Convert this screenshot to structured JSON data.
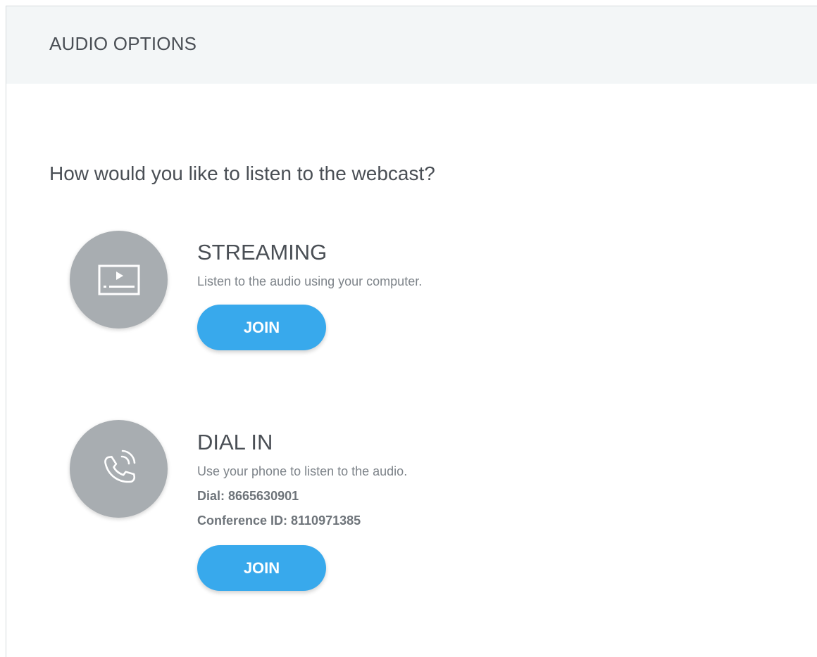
{
  "header": {
    "title": "AUDIO OPTIONS"
  },
  "prompt": {
    "question": "How would you like to listen to the webcast?"
  },
  "options": {
    "streaming": {
      "icon": "video-player-icon",
      "title": "STREAMING",
      "description": "Listen to the audio using your computer.",
      "button_label": "JOIN"
    },
    "dial_in": {
      "icon": "phone-ringing-icon",
      "title": "DIAL IN",
      "description": "Use your phone to listen to the audio.",
      "dial": "Dial: 8665630901",
      "conference_id": "Conference ID: 8110971385",
      "button_label": "JOIN"
    }
  },
  "colors": {
    "header_background": "#f3f6f7",
    "button_accent": "#38a9ec",
    "icon_circle": "#a8adb1",
    "text_primary": "#4a4f55",
    "text_secondary": "#7d8389"
  }
}
